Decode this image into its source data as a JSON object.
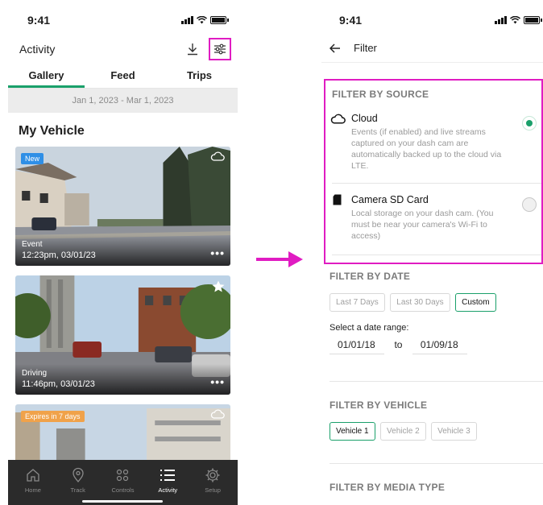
{
  "status": {
    "time": "9:41"
  },
  "activity": {
    "title": "Activity",
    "tabs": [
      {
        "label": "Gallery",
        "active": true
      },
      {
        "label": "Feed",
        "active": false
      },
      {
        "label": "Trips",
        "active": false
      }
    ],
    "date_range": "Jan 1, 2023 - Mar 1, 2023",
    "section_title": "My Vehicle",
    "cards": [
      {
        "badge": "New",
        "type": "Event",
        "time": "12:23pm, 03/01/23",
        "corner_icon": "cloud-icon",
        "more": "•••"
      },
      {
        "badge": "",
        "type": "Driving",
        "time": "11:46pm, 03/01/23",
        "corner_icon": "star-icon",
        "more": "•••"
      },
      {
        "badge": "Expires in 7 days",
        "type": "",
        "time": "",
        "corner_icon": "cloud-icon",
        "more": ""
      }
    ],
    "tabbar": [
      {
        "label": "Home",
        "icon": "home-icon",
        "active": false
      },
      {
        "label": "Track",
        "icon": "location-pin-icon",
        "active": false
      },
      {
        "label": "Controls",
        "icon": "controls-icon",
        "active": false
      },
      {
        "label": "Activity",
        "icon": "list-icon",
        "active": true
      },
      {
        "label": "Setup",
        "icon": "gear-icon",
        "active": false
      }
    ]
  },
  "filter": {
    "title": "Filter",
    "source": {
      "heading": "FILTER BY SOURCE",
      "options": [
        {
          "title": "Cloud",
          "icon": "cloud-icon",
          "desc": "Events (if enabled) and live streams captured on your dash cam are automatically backed up to the cloud via LTE.",
          "selected": true
        },
        {
          "title": "Camera SD Card",
          "icon": "sd-card-icon",
          "desc": "Local storage on your dash cam. (You must be near your camera's Wi-Fi to access)",
          "selected": false
        }
      ]
    },
    "date": {
      "heading": "FILTER BY DATE",
      "chips": [
        {
          "label": "Last 7 Days",
          "active": false
        },
        {
          "label": "Last 30 Days",
          "active": false
        },
        {
          "label": "Custom",
          "active": true
        }
      ],
      "range_label": "Select a date range:",
      "from": "01/01/18",
      "to_label": "to",
      "to": "01/09/18"
    },
    "vehicle": {
      "heading": "FILTER BY VEHICLE",
      "chips": [
        {
          "label": "Vehicle 1",
          "active": true
        },
        {
          "label": "Vehicle 2",
          "active": false
        },
        {
          "label": "Vehicle 3",
          "active": false
        }
      ]
    },
    "media": {
      "heading": "FILTER BY MEDIA TYPE"
    }
  },
  "colors": {
    "accent": "#1aa06a",
    "highlight": "#e01cc2",
    "badge_new": "#2f8fe6",
    "badge_expire": "#f0a24a",
    "tabbar": "#2b2b2b"
  }
}
